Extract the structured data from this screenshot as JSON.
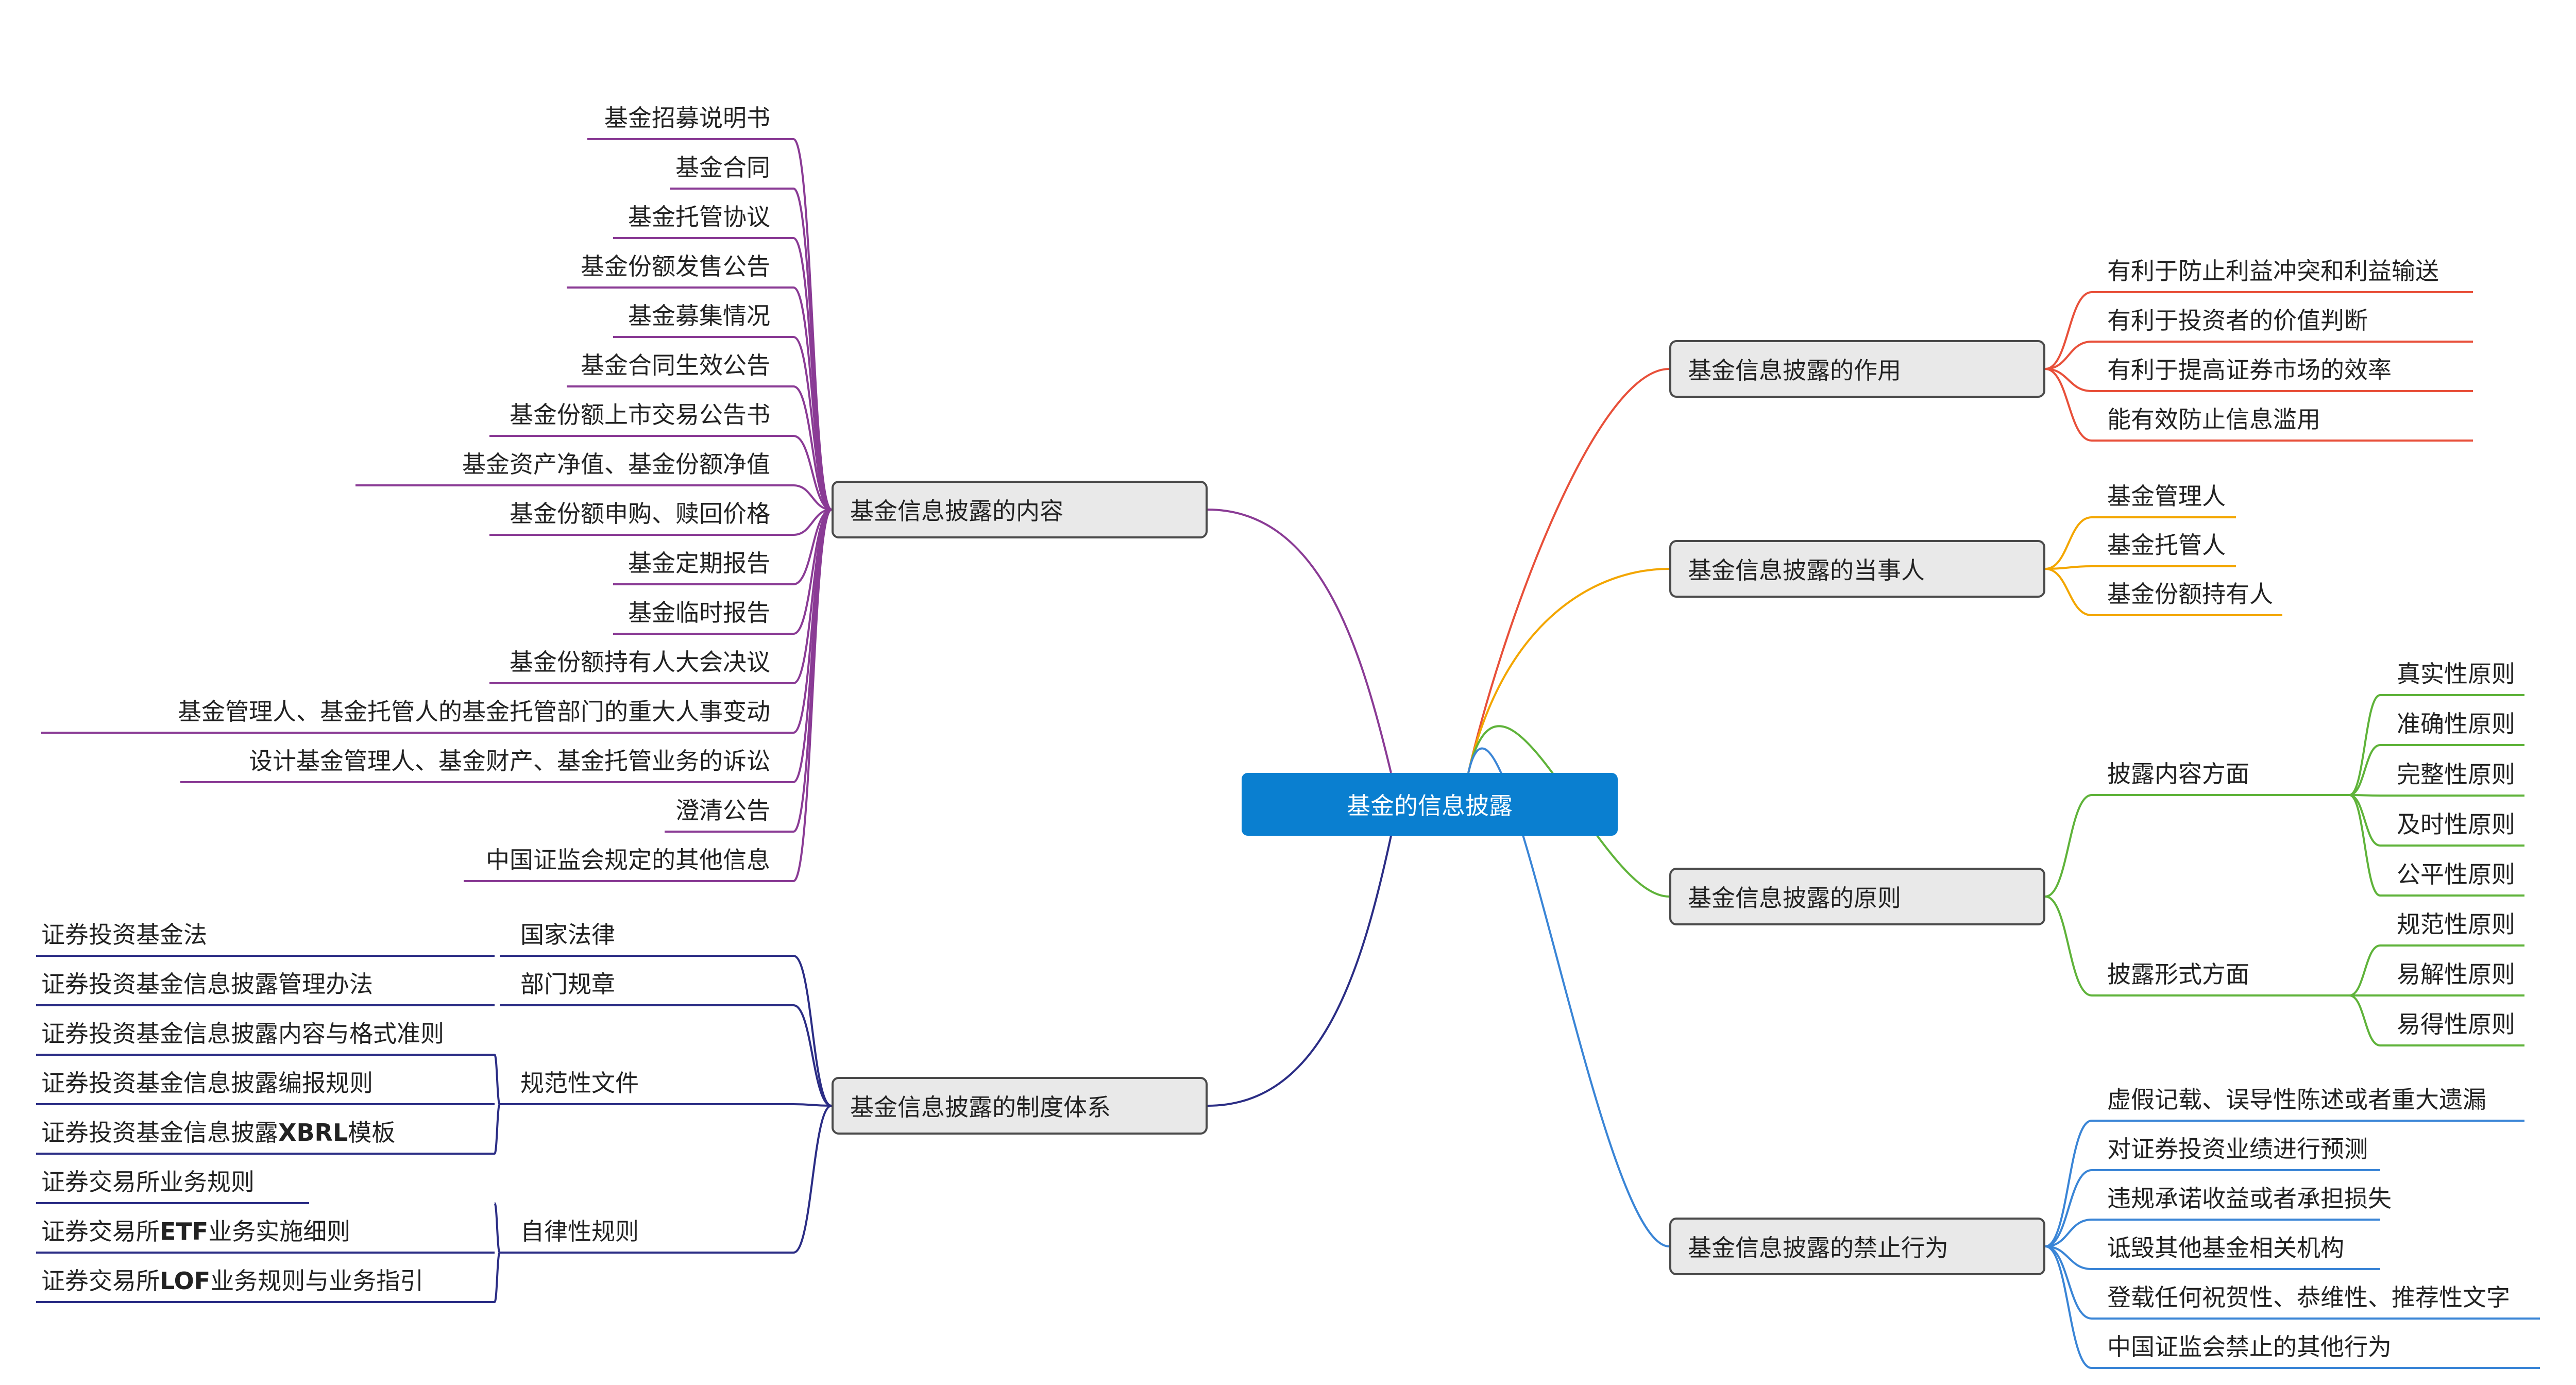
{
  "root": {
    "label": "基金的信息披露"
  },
  "branches": {
    "effect": {
      "label": "基金信息披露的作用",
      "color": "#e8503a",
      "items": [
        "有利于防止利益冲突和利益输送",
        "有利于投资者的价值判断",
        "有利于提高证券市场的效率",
        "能有效防止信息滥用"
      ]
    },
    "parties": {
      "label": "基金信息披露的当事人",
      "color": "#f3a600",
      "items": [
        "基金管理人",
        "基金托管人",
        "基金份额持有人"
      ]
    },
    "principles": {
      "label": "基金信息披露的原则",
      "color": "#5fb33a",
      "groups": [
        {
          "label": "披露内容方面",
          "items": [
            "真实性原则",
            "准确性原则",
            "完整性原则",
            "及时性原则",
            "公平性原则"
          ]
        },
        {
          "label": "披露形式方面",
          "items": [
            "规范性原则",
            "易解性原则",
            "易得性原则"
          ]
        }
      ]
    },
    "prohibited": {
      "label": "基金信息披露的禁止行为",
      "color": "#3a85d6",
      "items": [
        "虚假记载、误导性陈述或者重大遗漏",
        "对证券投资业绩进行预测",
        "违规承诺收益或者承担损失",
        "诋毁其他基金相关机构",
        "登载任何祝贺性、恭维性、推荐性文字",
        "中国证监会禁止的其他行为"
      ]
    },
    "content": {
      "label": "基金信息披露的内容",
      "color": "#8a3b95",
      "items": [
        "基金招募说明书",
        "基金合同",
        "基金托管协议",
        "基金份额发售公告",
        "基金募集情况",
        "基金合同生效公告",
        "基金份额上市交易公告书",
        "基金资产净值、基金份额净值",
        "基金份额申购、赎回价格",
        "基金定期报告",
        "基金临时报告",
        "基金份额持有人大会决议",
        "基金管理人、基金托管人的基金托管部门的重大人事变动",
        "设计基金管理人、基金财产、基金托管业务的诉讼",
        "澄清公告",
        "中国证监会规定的其他信息"
      ]
    },
    "system": {
      "label": "基金信息披露的制度体系",
      "color": "#2b2d85",
      "groups": [
        {
          "label": "国家法律",
          "items": [
            "证券投资基金法"
          ]
        },
        {
          "label": "部门规章",
          "items": [
            "证券投资基金信息披露管理办法"
          ]
        },
        {
          "label": "规范性文件",
          "items": [
            "证券投资基金信息披露内容与格式准则",
            "证券投资基金信息披露编报规则",
            "证券投资基金信息披露XBRL模板"
          ]
        },
        {
          "label": "自律性规则",
          "items": [
            "证券交易所业务规则",
            "证券交易所ETF业务实施细则",
            "证券交易所LOF业务规则与业务指引"
          ]
        }
      ]
    }
  }
}
